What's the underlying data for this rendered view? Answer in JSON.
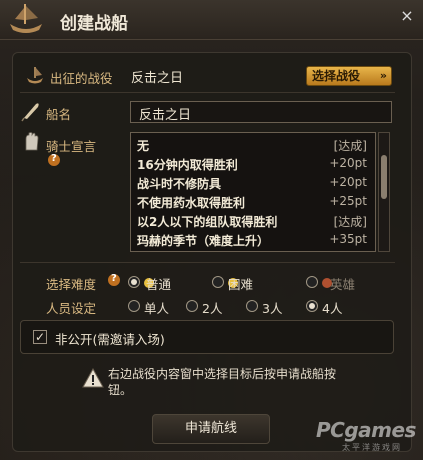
{
  "window": {
    "title": "创建战船",
    "close_label": "×"
  },
  "campaign": {
    "label": "出征的战役",
    "value": "反击之日",
    "select_button": "选择战役",
    "select_arrow": "»"
  },
  "ship_name": {
    "label": "船名",
    "value": "反击之日"
  },
  "oath": {
    "label": "骑士宣言",
    "items": [
      {
        "text": "无",
        "reward": "[达成]"
      },
      {
        "text": "16分钟内取得胜利",
        "reward": "+20pt"
      },
      {
        "text": "战斗时不修防具",
        "reward": "+20pt"
      },
      {
        "text": "不使用药水取得胜利",
        "reward": "+25pt"
      },
      {
        "text": "以2人以下的组队取得胜利",
        "reward": "[达成]"
      },
      {
        "text": "玛赫的季节（难度上升）",
        "reward": "+35pt"
      }
    ]
  },
  "difficulty": {
    "label": "选择难度",
    "options": [
      {
        "label": "普通",
        "selected": true,
        "color": "#e8c040"
      },
      {
        "label": "困难",
        "selected": false,
        "color": "#e8c040"
      },
      {
        "label": "英雄",
        "selected": false,
        "color": "#b05030",
        "disabled": true
      }
    ]
  },
  "party": {
    "label": "人员设定",
    "options": [
      {
        "label": "单人",
        "selected": false
      },
      {
        "label": "2人",
        "selected": false
      },
      {
        "label": "3人",
        "selected": false
      },
      {
        "label": "4人",
        "selected": true
      }
    ]
  },
  "private": {
    "label": "非公开(需邀请入场)",
    "checked": true,
    "check_mark": "✓"
  },
  "hint": "右边战役内容窗中选择目标后按申请战船按钮。",
  "apply_button": "申请航线",
  "watermark": {
    "big": "PCgames",
    "small": "太平洋游戏网"
  },
  "colors": {
    "accent": "#d9a53a",
    "label": "#d9b982"
  }
}
